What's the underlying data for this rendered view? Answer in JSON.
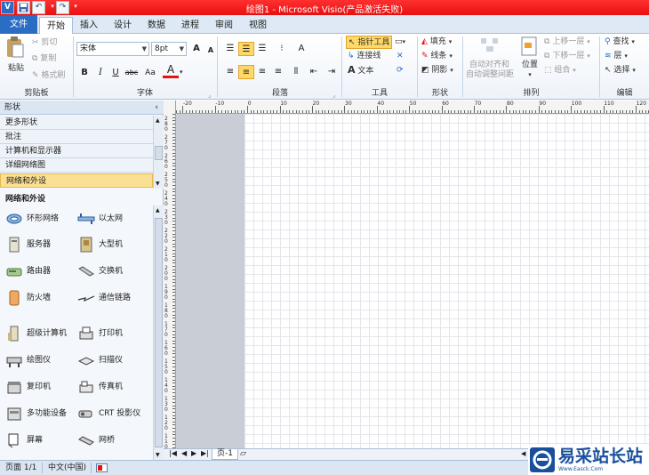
{
  "app": {
    "title": "绘图1 - Microsoft Visio(产品激活失败)",
    "colors": {
      "titlebar": "#e81010",
      "file_tab": "#2b6cc4",
      "ribbon_bg": "#eef3fa",
      "accent_select": "#ffd968"
    }
  },
  "quick_access": {
    "app_icon": "V",
    "save_icon": "save-icon",
    "undo_icon": "undo-icon",
    "redo_icon": "redo-icon"
  },
  "tabs": [
    "文件",
    "开始",
    "插入",
    "设计",
    "数据",
    "进程",
    "审阅",
    "视图"
  ],
  "ribbon": {
    "clipboard": {
      "label": "剪贴板",
      "paste": "粘贴",
      "cut": "剪切",
      "copy": "复制",
      "format_painter": "格式刷"
    },
    "font": {
      "label": "字体",
      "font_name": "宋体",
      "font_size": "8pt",
      "bold": "B",
      "italic": "I",
      "underline": "U",
      "strike": "abc",
      "case": "Aa",
      "grow": "A",
      "shrink": "A",
      "color": "A"
    },
    "paragraph": {
      "label": "段落"
    },
    "tools": {
      "label": "工具",
      "pointer": "指针工具",
      "connector": "连接线",
      "text": "文本"
    },
    "shape": {
      "label": "形状",
      "fill": "填充",
      "line": "线条",
      "shadow": "阴影"
    },
    "arrange": {
      "label": "排列",
      "auto_align": "自动对齐和",
      "auto_space": "自动调整间距",
      "position": "位置",
      "bring_forward": "上移一层",
      "send_backward": "下移一层",
      "group": "组合"
    },
    "editing": {
      "label": "编辑",
      "find": "查找",
      "layer": "层",
      "select": "选择"
    }
  },
  "shapes_pane": {
    "title": "形状",
    "stencils": [
      "更多形状",
      "批注",
      "计算机和显示器",
      "详细网络图",
      "网络和外设"
    ],
    "active_stencil": "网络和外设",
    "section_title": "网络和外设",
    "items": [
      {
        "label": "环形网络",
        "icon": "ring-network-icon"
      },
      {
        "label": "以太网",
        "icon": "ethernet-icon"
      },
      {
        "label": "服务器",
        "icon": "server-icon"
      },
      {
        "label": "大型机",
        "icon": "mainframe-icon"
      },
      {
        "label": "路由器",
        "icon": "router-icon"
      },
      {
        "label": "交换机",
        "icon": "switch-icon"
      },
      {
        "label": "防火墙",
        "icon": "firewall-icon"
      },
      {
        "label": "通信链路",
        "icon": "comm-link-icon"
      },
      {
        "label": "超级计算机",
        "icon": "supercomputer-icon"
      },
      {
        "label": "打印机",
        "icon": "printer-icon"
      },
      {
        "label": "绘图仪",
        "icon": "plotter-icon"
      },
      {
        "label": "扫描仪",
        "icon": "scanner-icon"
      },
      {
        "label": "复印机",
        "icon": "copier-icon"
      },
      {
        "label": "传真机",
        "icon": "fax-icon"
      },
      {
        "label": "多功能设备",
        "icon": "multifunction-device-icon"
      },
      {
        "label": "CRT 投影仪",
        "icon": "projector-icon"
      },
      {
        "label": "屏幕",
        "icon": "screen-icon"
      },
      {
        "label": "网桥",
        "icon": "bridge-icon"
      }
    ]
  },
  "ruler": {
    "h_labels": [
      "-20",
      "-10",
      "0",
      "10",
      "20",
      "30",
      "40",
      "50",
      "60",
      "70",
      "80",
      "90",
      "100",
      "110",
      "120"
    ],
    "v_labels": [
      "280",
      "270",
      "260",
      "250",
      "240",
      "230",
      "220",
      "210",
      "200",
      "190",
      "180",
      "170",
      "160",
      "150",
      "140",
      "130",
      "120",
      "110"
    ]
  },
  "page_tabs": {
    "current": "页-1"
  },
  "status": {
    "page": "页面 1/1",
    "language": "中文(中国)"
  },
  "watermark": {
    "text": "易采站长站",
    "subtext": "Www.Easck.Com"
  }
}
